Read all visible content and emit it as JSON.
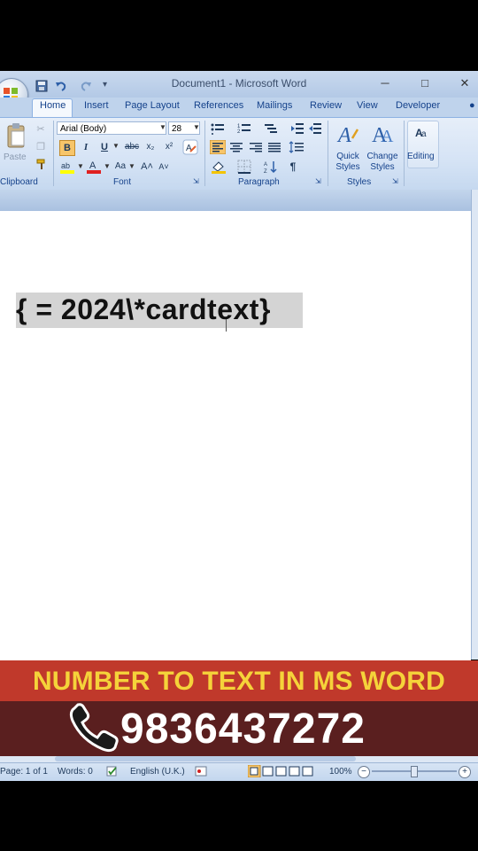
{
  "window": {
    "title": "Document1 - Microsoft Word",
    "minimize": "─",
    "maximize": "□",
    "close": "✕"
  },
  "tabs": [
    "Home",
    "Insert",
    "Page Layout",
    "References",
    "Mailings",
    "Review",
    "View",
    "Developer"
  ],
  "ribbon": {
    "clipboard": {
      "paste_label": "Paste",
      "group_label": "Clipboard"
    },
    "font": {
      "font_name": "Arial (Body)",
      "font_size": "28",
      "bold": "B",
      "italic": "I",
      "underline": "U",
      "strike": "abc",
      "subscript": "x₂",
      "superscript": "x²",
      "change_case": "Aa",
      "grow": "A˄",
      "shrink": "A˅",
      "group_label": "Font"
    },
    "paragraph": {
      "group_label": "Paragraph",
      "pilcrow": "¶"
    },
    "styles": {
      "quick_styles": [
        "Quick",
        "Styles"
      ],
      "change_styles": [
        "Change",
        "Styles"
      ],
      "group_label": "Styles"
    },
    "editing": {
      "label": "Editing"
    }
  },
  "document": {
    "field_code": "{ =  2024\\*cardtext}"
  },
  "overlay": {
    "banner": "NUMBER TO TEXT IN MS WORD",
    "phone": "9836437272"
  },
  "status": {
    "page": "Page: 1 of 1",
    "words": "Words: 0",
    "language": "English (U.K.)",
    "zoom": "100%"
  },
  "colors": {
    "banner_bg": "#c0392b",
    "banner_text": "#f5d33a",
    "phone_bg": "#5a1f1f",
    "ribbon_blue": "#15428b"
  }
}
